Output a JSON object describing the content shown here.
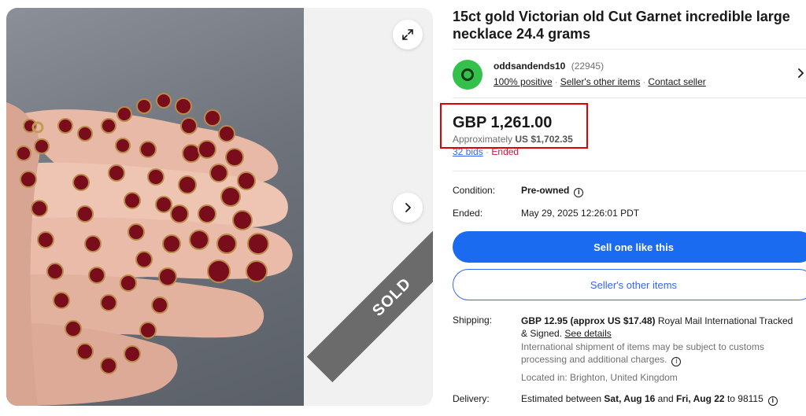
{
  "gallery": {
    "expand_icon": "expand-icon",
    "next_icon": "chevron-right-icon",
    "sold_label": "SOLD"
  },
  "listing": {
    "title": "15ct gold Victorian old Cut Garnet incredible large necklace 24.4 grams"
  },
  "seller": {
    "avatar_color": "#34c14b",
    "name": "oddsandends10",
    "score": "(22945)",
    "positive": "100% positive",
    "other_items": "Seller's other items",
    "contact": "Contact seller",
    "chevron_icon": "chevron-right-icon"
  },
  "price": {
    "main": "GBP 1,261.00",
    "approx_prefix": "Approximately",
    "approx_value": "US $1,702.35",
    "bids": "32 bids",
    "separator": "·",
    "status": "Ended",
    "highlight_color": "#e00000"
  },
  "condition": {
    "label": "Condition:",
    "value": "Pre-owned",
    "info_icon": "info-icon"
  },
  "ended": {
    "label": "Ended:",
    "value": "May 29, 2025 12:26:01 PDT"
  },
  "buttons": {
    "sell_one": "Sell one like this",
    "sellers_other": "Seller's other items",
    "primary_color": "#1a6bf0"
  },
  "shipping": {
    "label": "Shipping:",
    "cost": "GBP 12.95 (approx US $17.48)",
    "service": "Royal Mail International Tracked & Signed.",
    "see_details": "See details",
    "note": "International shipment of items may be subject to customs processing and additional charges.",
    "location": "Located in: Brighton, United Kingdom"
  },
  "delivery": {
    "label": "Delivery:",
    "prefix": "Estimated between",
    "start": "Sat, Aug 16",
    "and": "and",
    "end": "Fri, Aug 22",
    "to": "to 98115"
  }
}
